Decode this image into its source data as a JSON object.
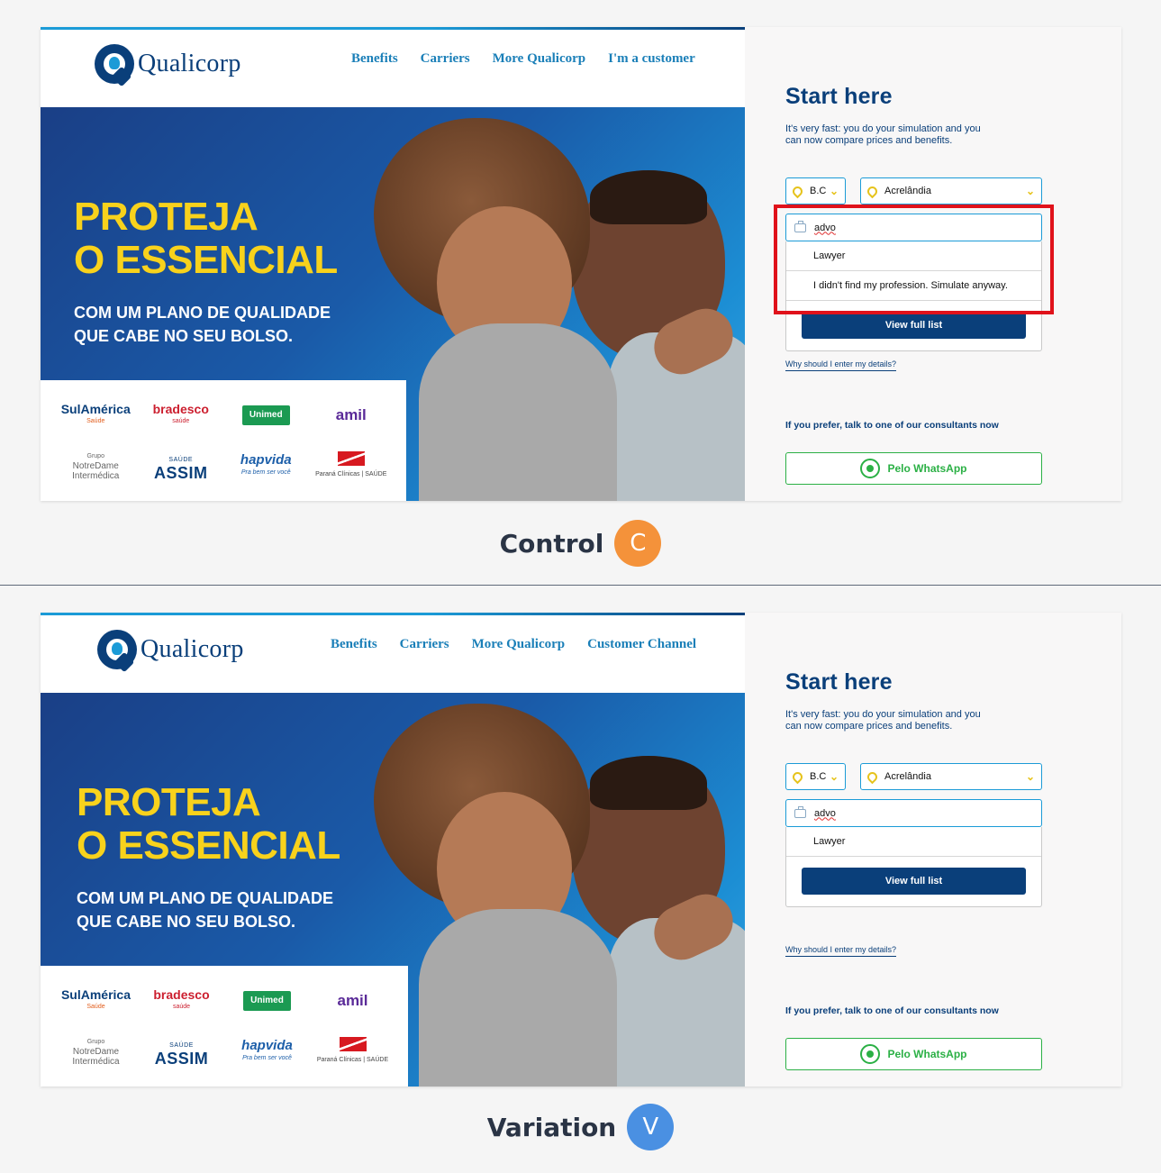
{
  "control": {
    "nav": [
      "Benefits",
      "Carriers",
      "More Qualicorp",
      "I'm a customer"
    ],
    "options": [
      "Lawyer",
      "I didn't find my profession. Simulate anyway."
    ],
    "label": "Control",
    "badge": "C"
  },
  "variation": {
    "nav": [
      "Benefits",
      "Carriers",
      "More Qualicorp",
      "Customer Channel"
    ],
    "options": [
      "Lawyer"
    ],
    "label": "Variation",
    "badge": "V"
  },
  "shared": {
    "logo_text": "Qualicorp",
    "hero_title_1": "PROTEJA",
    "hero_title_2": "O ESSENCIAL",
    "hero_sub_1": "COM UM PLANO DE QUALIDADE",
    "hero_sub_2": "QUE CABE NO SEU BOLSO.",
    "start_title": "Start here",
    "description": "It's very fast: you do your simulation and you can now compare prices and benefits.",
    "state_value": "B.C",
    "city_value": "Acrelândia",
    "profession_value": "advo",
    "view_full_list": "View full list",
    "why_link": "Why should I enter my details?",
    "consultants_text": "If you prefer, talk to one of our consultants now",
    "whatsapp_label": "Pelo WhatsApp"
  },
  "brands": {
    "sulamerica": "SulAmérica",
    "sulamerica_sub": "Saúde",
    "bradesco": "bradesco",
    "bradesco_sub": "saúde",
    "unimed": "Unimed",
    "amil": "amil",
    "notredame_top": "Grupo",
    "notredame_1": "NotreDame",
    "notredame_2": "Intermédica",
    "assim": "ASSIM",
    "assim_sub": "SAÚDE",
    "hapvida": "hapvida",
    "hapvida_sub": "Pra bem ser você",
    "parana": "Paraná Clínicas | SAÚDE"
  },
  "colors": {
    "brand_navy": "#0a3f7a",
    "brand_blue": "#1b9bd7",
    "hero_yellow": "#f8d21c",
    "whatsapp_green": "#2bb045",
    "highlight_red": "#e0121b",
    "control_badge": "#f4923a",
    "variation_badge": "#4a90e2"
  }
}
